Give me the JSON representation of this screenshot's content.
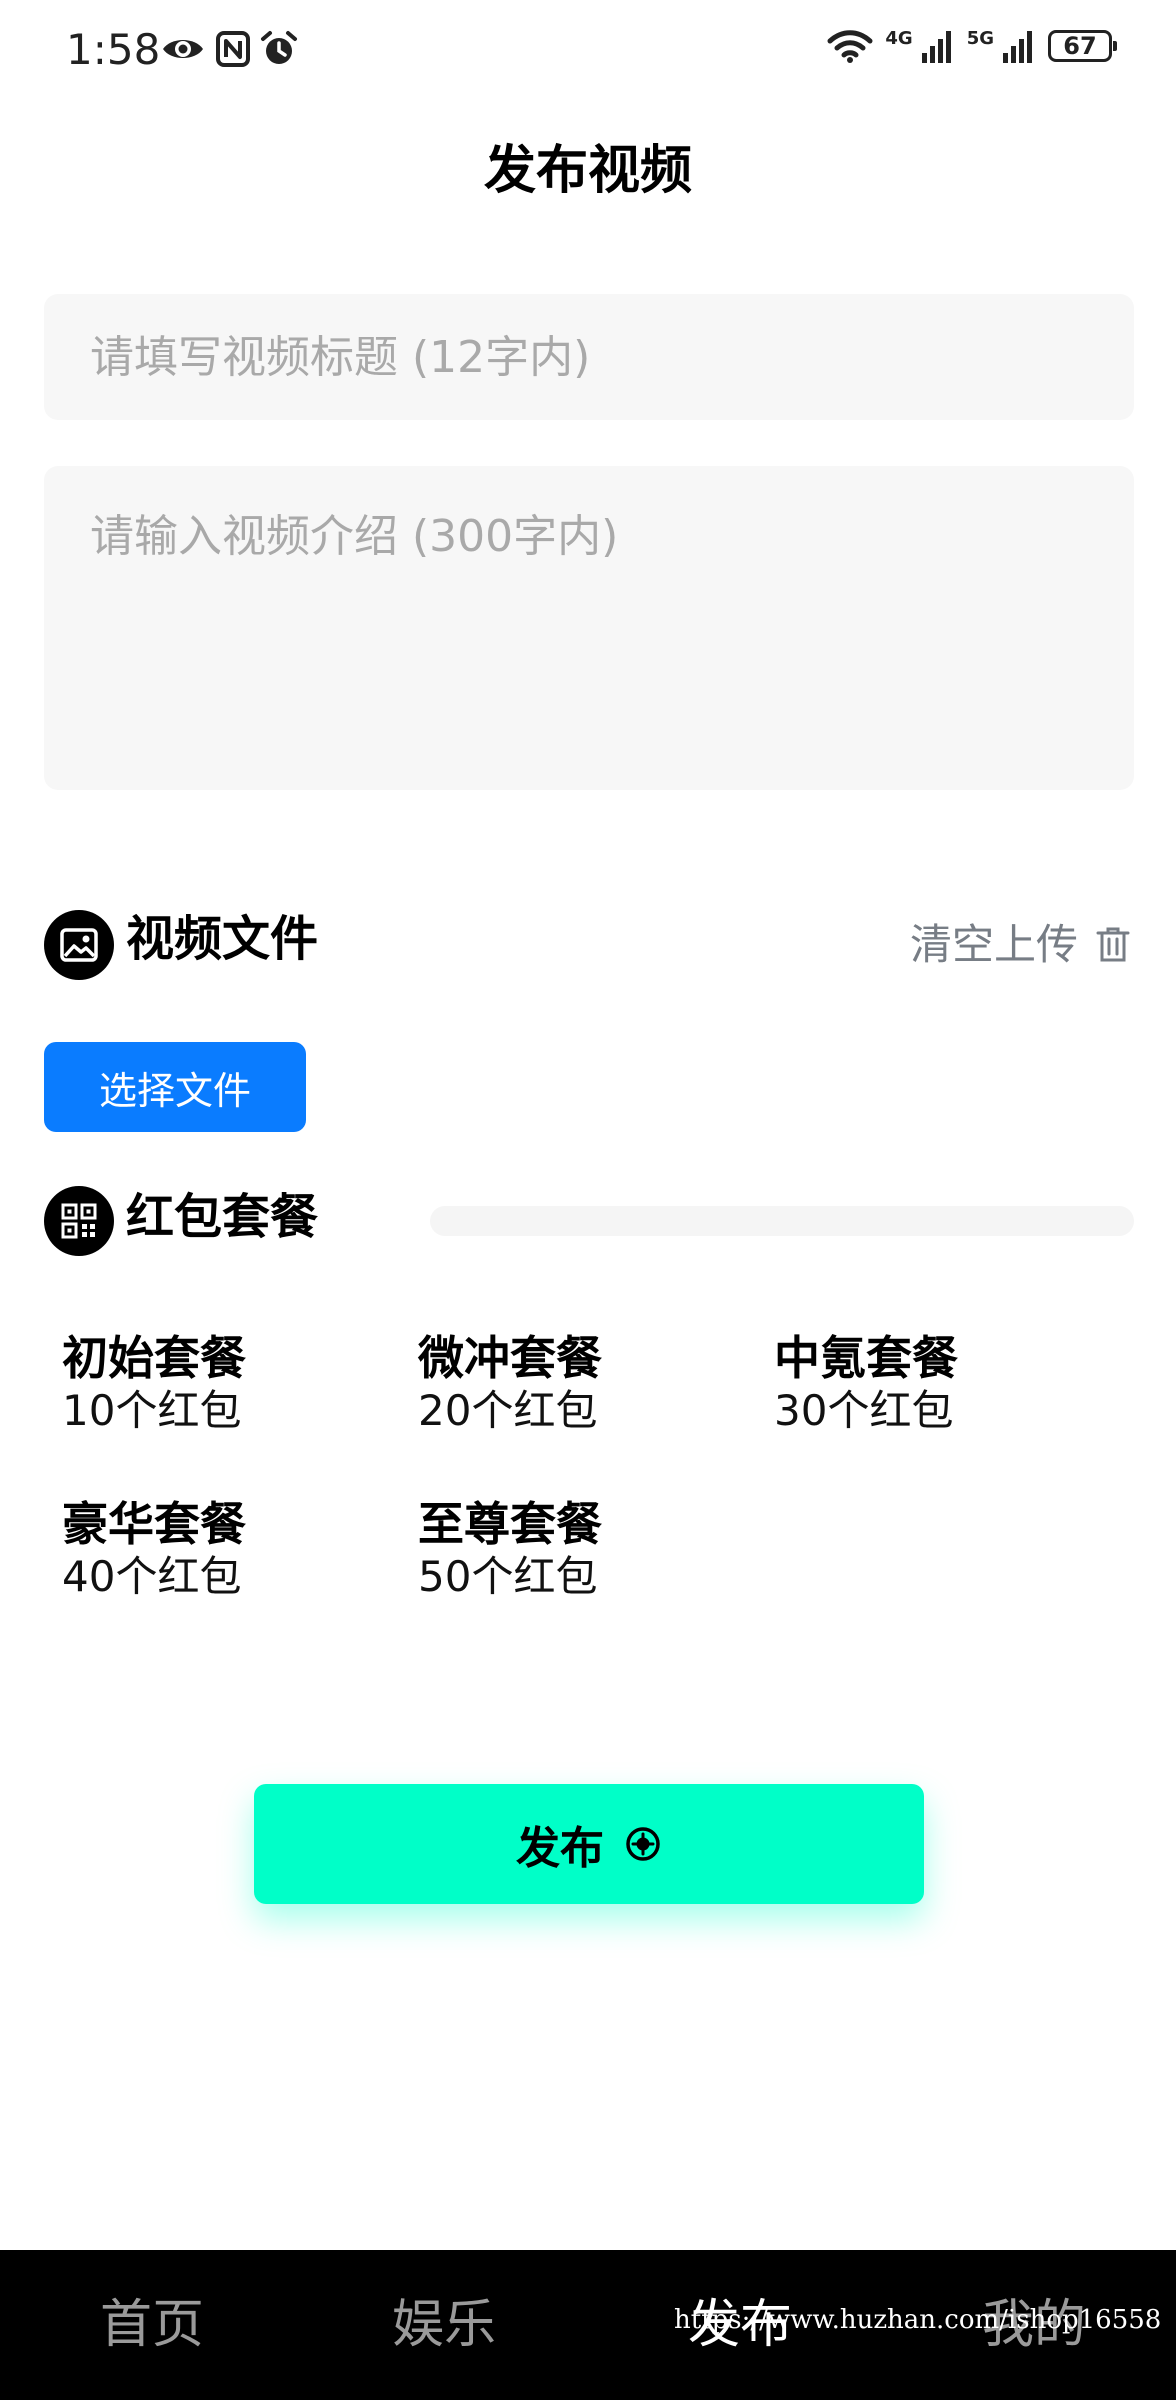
{
  "status_bar": {
    "time": "1:58",
    "left_icons": [
      "eye-icon",
      "nfc-icon",
      "alarm-icon"
    ],
    "net1": "4G",
    "net2": "5G",
    "battery": "67"
  },
  "header": {
    "title": "发布视频"
  },
  "form": {
    "title_placeholder": "请填写视频标题 (12字内)",
    "desc_placeholder": "请输入视频介绍 (300字内)"
  },
  "video_section": {
    "title": "视频文件",
    "clear_label": "清空上传",
    "choose_label": "选择文件"
  },
  "redpacket_section": {
    "title": "红包套餐",
    "packages": [
      {
        "name": "初始套餐",
        "count": "10个红包"
      },
      {
        "name": "微冲套餐",
        "count": "20个红包"
      },
      {
        "name": "中氪套餐",
        "count": "30个红包"
      },
      {
        "name": "豪华套餐",
        "count": "40个红包"
      },
      {
        "name": "至尊套餐",
        "count": "50个红包"
      }
    ]
  },
  "publish": {
    "label": "发布"
  },
  "bottom_nav": {
    "items": [
      {
        "label": "首页"
      },
      {
        "label": "娱乐"
      },
      {
        "label": "发布"
      },
      {
        "label": "我的"
      }
    ],
    "active_index": 2,
    "watermark": "https://www.huzhan.com/ishop16558"
  },
  "colors": {
    "choose_button": "#0a7cff",
    "publish_button": "#00ffc8",
    "nav_background": "#000000"
  }
}
